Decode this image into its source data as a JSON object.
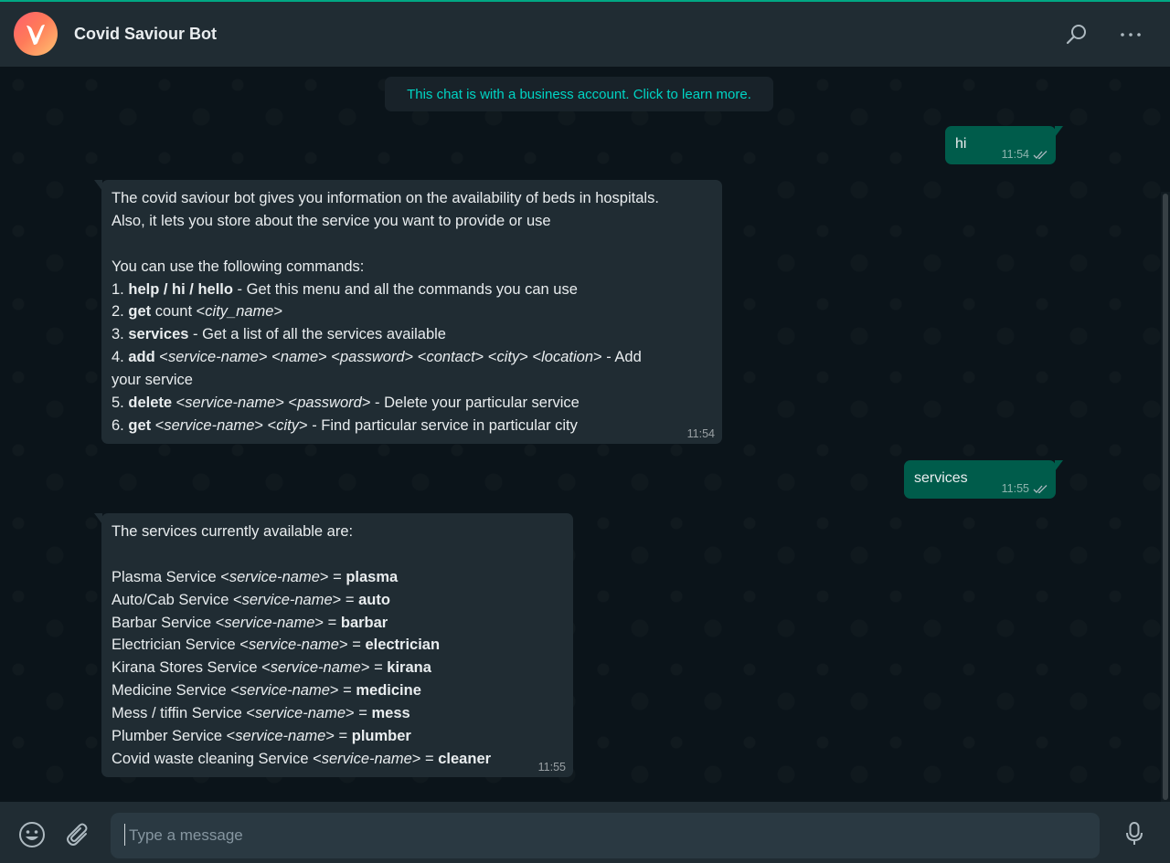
{
  "header": {
    "contact_name": "Covid Saviour Bot",
    "avatar_letter": "V"
  },
  "chat": {
    "system_message": "This chat is with a business account. Click to learn more.",
    "messages": [
      {
        "direction": "out",
        "text": "hi",
        "time": "11:54",
        "status": "read"
      },
      {
        "direction": "in",
        "time": "11:54",
        "lines": [
          "The covid saviour bot gives you information on the availability of beds in hospitals.",
          "Also, it lets you store about the service you want to provide or use",
          "",
          "You can use the following commands:",
          "1. help / hi / hello - Get this menu and all the commands you can use",
          "2. get count <city_name>",
          "3. services - Get a list of all the services available",
          "4. add <service-name> <name> <password> <contact> <city> <location> - Add",
          "your service",
          "5. delete <service-name> <password> - Delete your particular service",
          "6. get <service-name> <city> - Find particular service in particular city"
        ]
      },
      {
        "direction": "out",
        "text": "services",
        "time": "11:55",
        "status": "read"
      },
      {
        "direction": "in",
        "time": "11:55",
        "lines": [
          "The services currently available are:",
          "",
          "Plasma Service <service-name> = plasma",
          "Auto/Cab Service <service-name> = auto",
          "Barbar Service <service-name> = barbar",
          "Electrician Service <service-name> = electrician",
          "Kirana Stores Service <service-name> = kirana",
          "Medicine Service <service-name> = medicine",
          "Mess / tiffin Service <service-name> = mess",
          "Plumber Service <service-name> = plumber",
          "Covid waste cleaning Service <service-name> = cleaner"
        ]
      }
    ]
  },
  "composer": {
    "placeholder": "Type a message"
  },
  "icons": {
    "header": [
      "search-icon",
      "menu-dots-icon"
    ],
    "footer": [
      "emoji-icon",
      "attach-icon",
      "microphone-icon"
    ],
    "status": "double-check-icon"
  },
  "colors": {
    "accent": "#00a884",
    "outgoing_bubble": "#005c4b",
    "incoming_bubble": "#202c33",
    "system_text": "#00d4c4"
  }
}
